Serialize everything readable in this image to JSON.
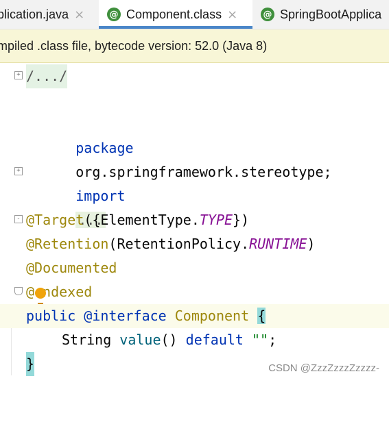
{
  "tabs": [
    {
      "label": "plication.java",
      "active": false,
      "icon": ""
    },
    {
      "label": "Component.class",
      "active": true,
      "icon": "class-icon"
    },
    {
      "label": "SpringBootApplica",
      "active": false,
      "icon": "class-icon"
    }
  ],
  "tab_close_glyph": "×",
  "class_icon_glyph": "@",
  "banner": {
    "text": "mpiled .class file, bytecode version: 52.0 (Java 8)"
  },
  "code": {
    "header_fold": "/.../",
    "package_kw": "package",
    "package_name": "org.springframework.stereotype;",
    "import_kw": "import",
    "import_fold": "...",
    "target_ann": "@Target",
    "target_args_open": "({ElementType.",
    "target_const": "TYPE",
    "target_args_close": "})",
    "retention_ann": "@Retention",
    "retention_args_open": "(RetentionPolicy.",
    "retention_const": "RUNTIME",
    "retention_args_close": ")",
    "documented_ann": "@Documented",
    "indexed_ann_prefix": "@",
    "indexed_ann_rest": "ndexed",
    "public_kw": "public",
    "interface_kw": "@interface",
    "interface_name": "Component",
    "open_brace": "{",
    "string_type": "String",
    "method_name": "value",
    "method_parens": "()",
    "default_kw": "default",
    "default_value": "\"\"",
    "semicolon": ";",
    "close_brace": "}"
  },
  "watermark": "CSDN @ZzzZzzzZzzzz-",
  "colors": {
    "keyword": "#0033b3",
    "annotation": "#9e880d",
    "constant": "#871094",
    "string": "#067d17",
    "method": "#00627a",
    "active_tab_underline": "#4a86c8",
    "banner_bg": "#f8f6d7",
    "class_icon": "#3f8f3c"
  }
}
